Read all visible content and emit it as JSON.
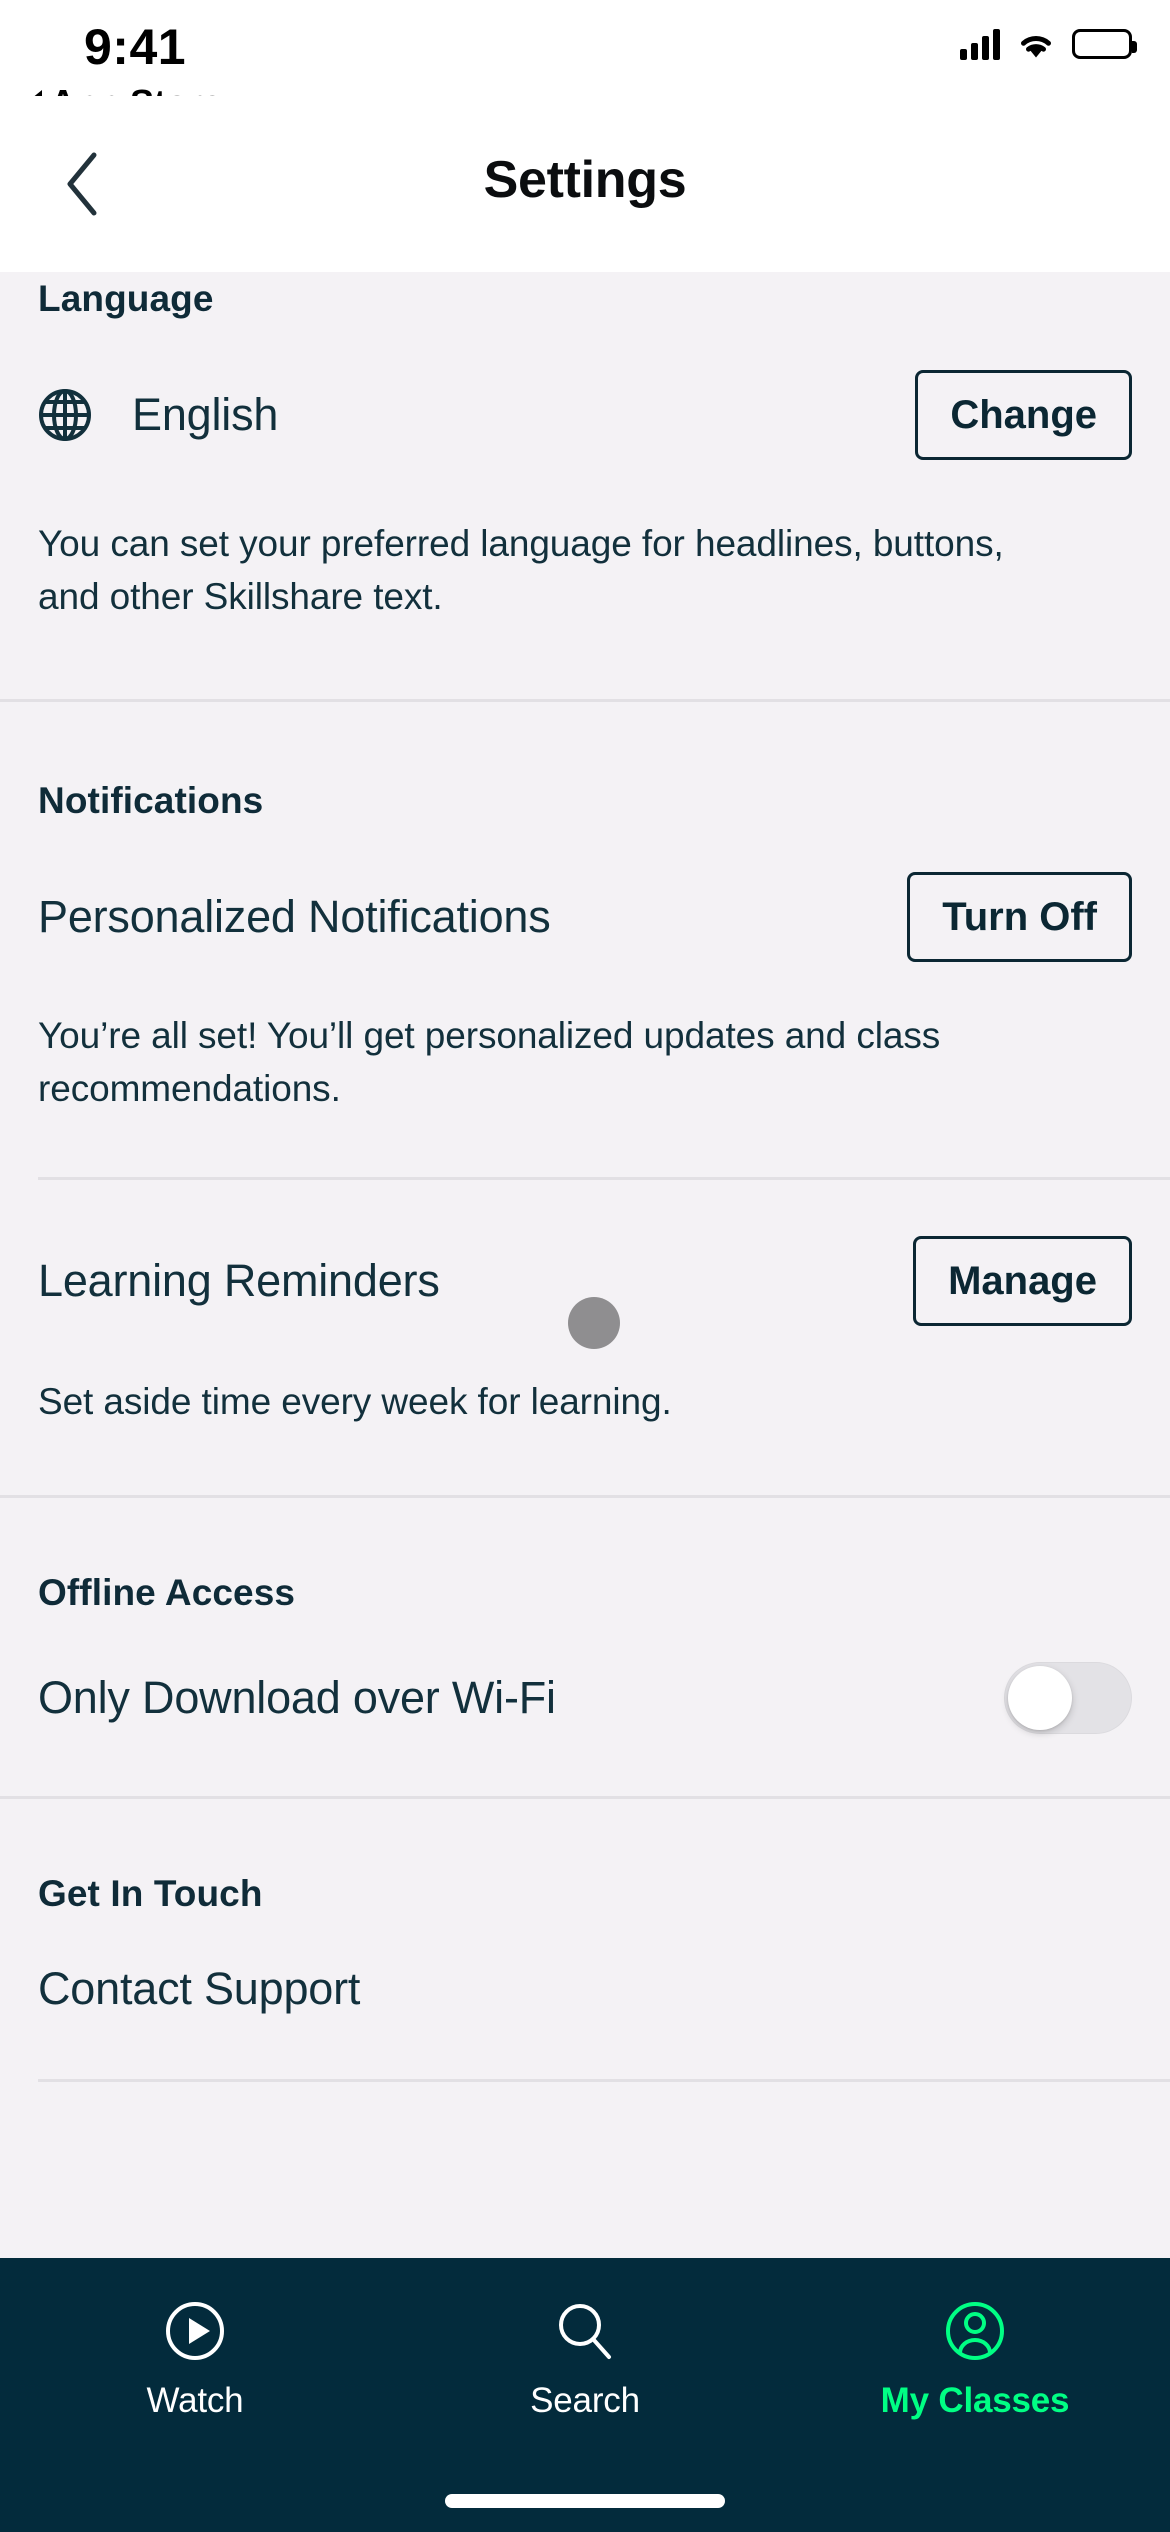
{
  "status_bar": {
    "time": "9:41",
    "back_app_label": "App Store",
    "signal_icon": "cellular-bars-icon",
    "wifi_icon": "wifi-icon",
    "battery_icon": "battery-full-icon"
  },
  "nav": {
    "title": "Settings",
    "back_icon": "chevron-left-icon"
  },
  "sections": {
    "language": {
      "heading": "Language",
      "icon": "globe-icon",
      "value": "English",
      "button_label": "Change",
      "description": "You can set your preferred language for headlines, buttons, and other Skillshare text."
    },
    "notifications": {
      "heading": "Notifications",
      "personalized": {
        "label": "Personalized Notifications",
        "button_label": "Turn Off",
        "description": "You’re all set! You’ll get personalized updates and class recommendations."
      },
      "reminders": {
        "label": "Learning Reminders",
        "button_label": "Manage",
        "description": "Set aside time every week for learning."
      }
    },
    "offline": {
      "heading": "Offline Access",
      "wifi_only": {
        "label": "Only Download over Wi-Fi",
        "toggle_state": "off"
      }
    },
    "get_in_touch": {
      "heading": "Get In Touch",
      "contact_support": "Contact Support"
    }
  },
  "tab_bar": {
    "items": [
      {
        "label": "Watch",
        "icon": "play-circle-icon",
        "active": false
      },
      {
        "label": "Search",
        "icon": "magnifier-icon",
        "active": false
      },
      {
        "label": "My Classes",
        "icon": "person-circle-icon",
        "active": true
      }
    ]
  },
  "colors": {
    "background": "#f4f2f5",
    "text_primary": "#12303c",
    "tabbar_background": "#032b3c",
    "accent_green": "#00ff84",
    "divider": "#e2e0e4"
  }
}
